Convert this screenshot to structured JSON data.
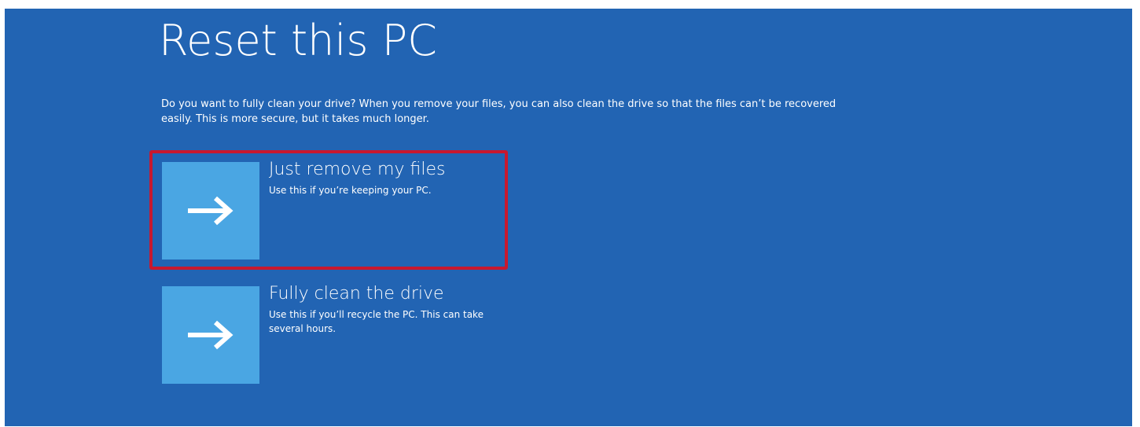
{
  "page": {
    "title": "Reset this PC",
    "description": "Do you want to fully clean your drive? When you remove your files, you can also clean the drive so that the files can’t be recovered easily. This is more secure, but it takes much longer."
  },
  "options": [
    {
      "title": "Just remove my files",
      "description": "Use this if you’re keeping your PC.",
      "icon": "arrow-right-icon",
      "highlighted": true
    },
    {
      "title": "Fully clean the drive",
      "description": "Use this if you’ll recycle the PC. This can take several hours.",
      "icon": "arrow-right-icon",
      "highlighted": false
    }
  ],
  "colors": {
    "background": "#2264b3",
    "tile": "#4aa6e3",
    "highlight_border": "#c8182f",
    "text": "#ffffff"
  }
}
